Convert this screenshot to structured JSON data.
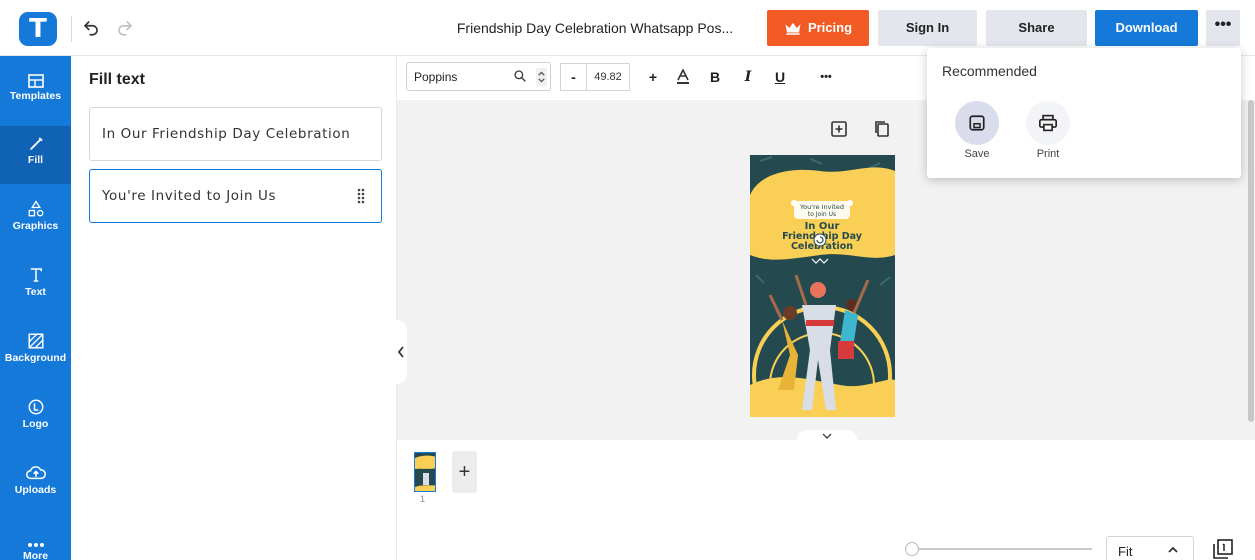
{
  "header": {
    "logo_letter": "T",
    "doc_title": "Friendship Day Celebration Whatsapp Pos...",
    "pricing_label": "Pricing",
    "signin_label": "Sign In",
    "share_label": "Share",
    "download_label": "Download",
    "more_label": "•••"
  },
  "sidebar": {
    "items": [
      {
        "label": "Templates",
        "icon": "templates-icon"
      },
      {
        "label": "Fill",
        "icon": "pencil-icon"
      },
      {
        "label": "Graphics",
        "icon": "shapes-icon"
      },
      {
        "label": "Text",
        "icon": "text-icon"
      },
      {
        "label": "Background",
        "icon": "background-icon"
      },
      {
        "label": "Logo",
        "icon": "logo-icon"
      },
      {
        "label": "Uploads",
        "icon": "cloud-upload-icon"
      },
      {
        "label": "More",
        "icon": "more-icon"
      }
    ]
  },
  "fill_panel": {
    "title": "Fill text",
    "fields": [
      {
        "value": "In Our Friendship Day Celebration"
      },
      {
        "value": "You're Invited to Join Us"
      }
    ]
  },
  "toolbar": {
    "font_name": "Poppins",
    "font_size": "49.82",
    "minus": "-",
    "plus": "+",
    "bold": "B",
    "italic": "I",
    "underline": "U",
    "more": "•••"
  },
  "recommended": {
    "title": "Recommended",
    "save_label": "Save",
    "print_label": "Print"
  },
  "poster": {
    "invite_line1": "You're Invited",
    "invite_line2": "to Join Us",
    "headline1": "In Our",
    "headline2": "Friendship Day",
    "headline3": "Celebration",
    "colors": {
      "bg": "#244a4f",
      "yellow": "#f9cf55"
    }
  },
  "pages": {
    "page_number": "1",
    "add_label": "+"
  },
  "zoom": {
    "fit_label": "Fit"
  },
  "colors": {
    "brand_blue": "#1479d8",
    "pricing_orange": "#f25a23"
  }
}
